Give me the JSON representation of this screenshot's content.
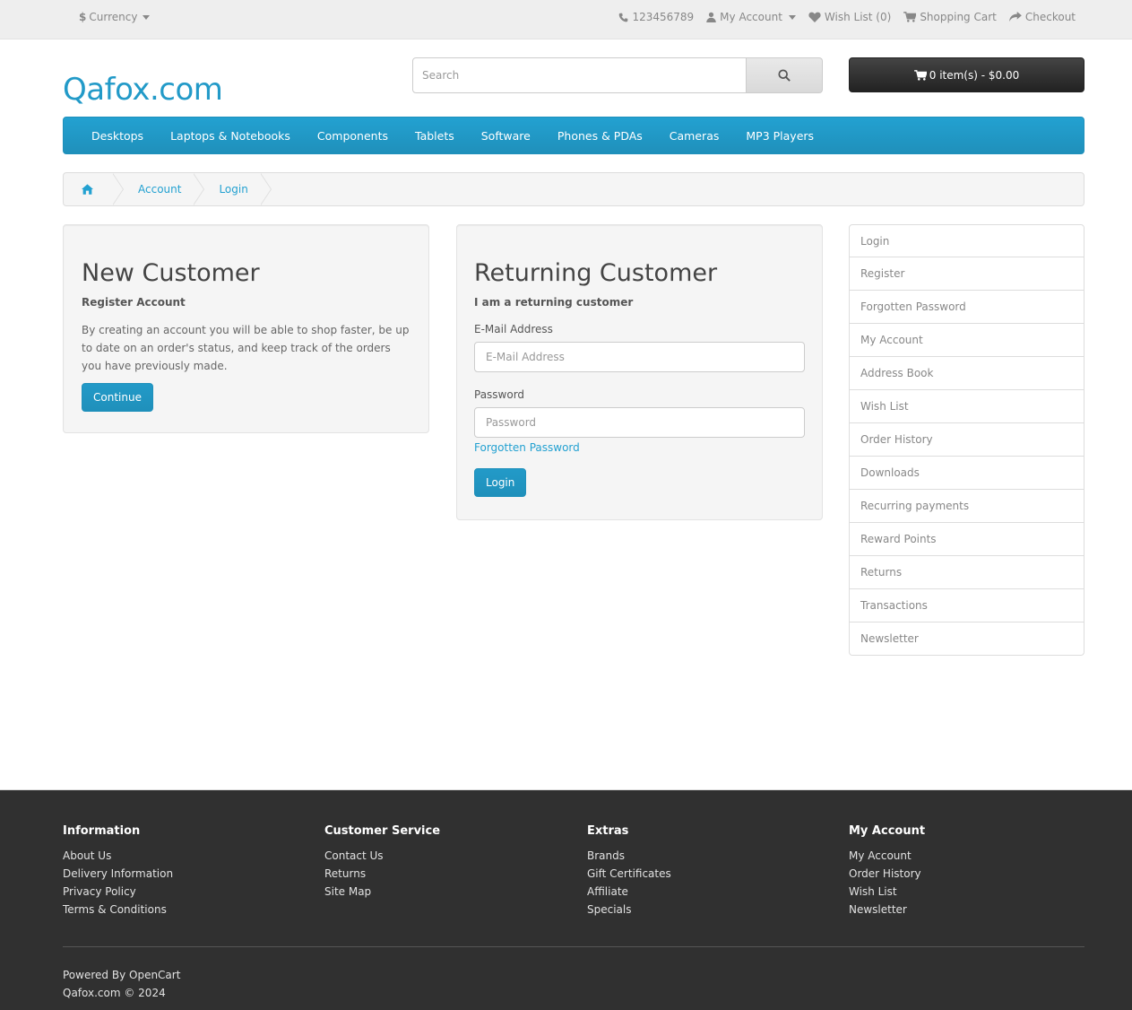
{
  "topbar": {
    "currency": "Currency",
    "phone": "123456789",
    "my_account": "My Account",
    "wish_list": "Wish List (0)",
    "shopping_cart": "Shopping Cart",
    "checkout": "Checkout"
  },
  "header": {
    "logo": "Qafox.com",
    "search_placeholder": "Search",
    "cart_label": "0 item(s) - $0.00"
  },
  "menu": [
    "Desktops",
    "Laptops & Notebooks",
    "Components",
    "Tablets",
    "Software",
    "Phones & PDAs",
    "Cameras",
    "MP3 Players"
  ],
  "breadcrumb": [
    "Account",
    "Login"
  ],
  "new_customer": {
    "title": "New Customer",
    "subtitle": "Register Account",
    "text": "By creating an account you will be able to shop faster, be up to date on an order's status, and keep track of the orders you have previously made.",
    "button": "Continue"
  },
  "returning_customer": {
    "title": "Returning Customer",
    "subtitle": "I am a returning customer",
    "email_label": "E-Mail Address",
    "email_placeholder": "E-Mail Address",
    "password_label": "Password",
    "password_placeholder": "Password",
    "forgotten": "Forgotten Password",
    "button": "Login"
  },
  "sidebar": [
    "Login",
    "Register",
    "Forgotten Password",
    "My Account",
    "Address Book",
    "Wish List",
    "Order History",
    "Downloads",
    "Recurring payments",
    "Reward Points",
    "Returns",
    "Transactions",
    "Newsletter"
  ],
  "footer": {
    "columns": [
      {
        "title": "Information",
        "links": [
          "About Us",
          "Delivery Information",
          "Privacy Policy",
          "Terms & Conditions"
        ]
      },
      {
        "title": "Customer Service",
        "links": [
          "Contact Us",
          "Returns",
          "Site Map"
        ]
      },
      {
        "title": "Extras",
        "links": [
          "Brands",
          "Gift Certificates",
          "Affiliate",
          "Specials"
        ]
      },
      {
        "title": "My Account",
        "links": [
          "My Account",
          "Order History",
          "Wish List",
          "Newsletter"
        ]
      }
    ],
    "powered_prefix": "Powered By",
    "powered_link": "OpenCart",
    "copyright": "Qafox.com © 2024"
  },
  "colors": {
    "accent": "#229ac8",
    "footer_bg": "#303030",
    "topbar_bg": "#eeeeee"
  }
}
